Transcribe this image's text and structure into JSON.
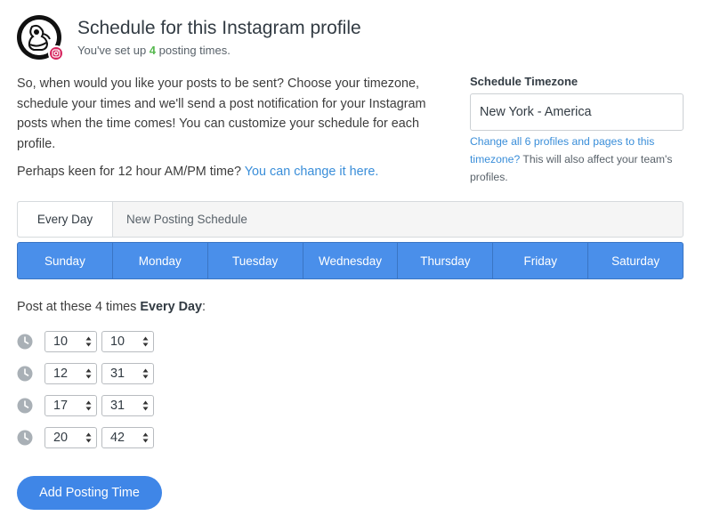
{
  "header": {
    "title": "Schedule for this Instagram profile",
    "subtitle_before": "You've set up ",
    "posting_count": "4",
    "subtitle_after": " posting times."
  },
  "intro": "So, when would you like your posts to be sent? Choose your timezone, schedule your times and we'll send a post notification for your Instagram posts when the time comes! You can customize your schedule for each profile.",
  "hour_pref": {
    "text": "Perhaps keen for 12 hour AM/PM time?",
    "link": "You can change it here."
  },
  "timezone": {
    "label": "Schedule Timezone",
    "value": "New York - America",
    "note_link": "Change all 6 profiles and pages to this timezone?",
    "note_text": " This will also affect your team's profiles."
  },
  "schedule_tabs": [
    "Every Day",
    "New Posting Schedule"
  ],
  "days": [
    "Sunday",
    "Monday",
    "Tuesday",
    "Wednesday",
    "Thursday",
    "Friday",
    "Saturday"
  ],
  "post_at": {
    "before": "Post at these 4 times ",
    "bold": "Every Day",
    "after": ":"
  },
  "times": [
    {
      "hour": "10",
      "minute": "10"
    },
    {
      "hour": "12",
      "minute": "31"
    },
    {
      "hour": "17",
      "minute": "31"
    },
    {
      "hour": "20",
      "minute": "42"
    }
  ],
  "add_button": "Add Posting Time",
  "colors": {
    "accent": "#4a8fea",
    "link": "#3a8ed9",
    "count": "#56b84f",
    "instagram": "#d6245e"
  }
}
